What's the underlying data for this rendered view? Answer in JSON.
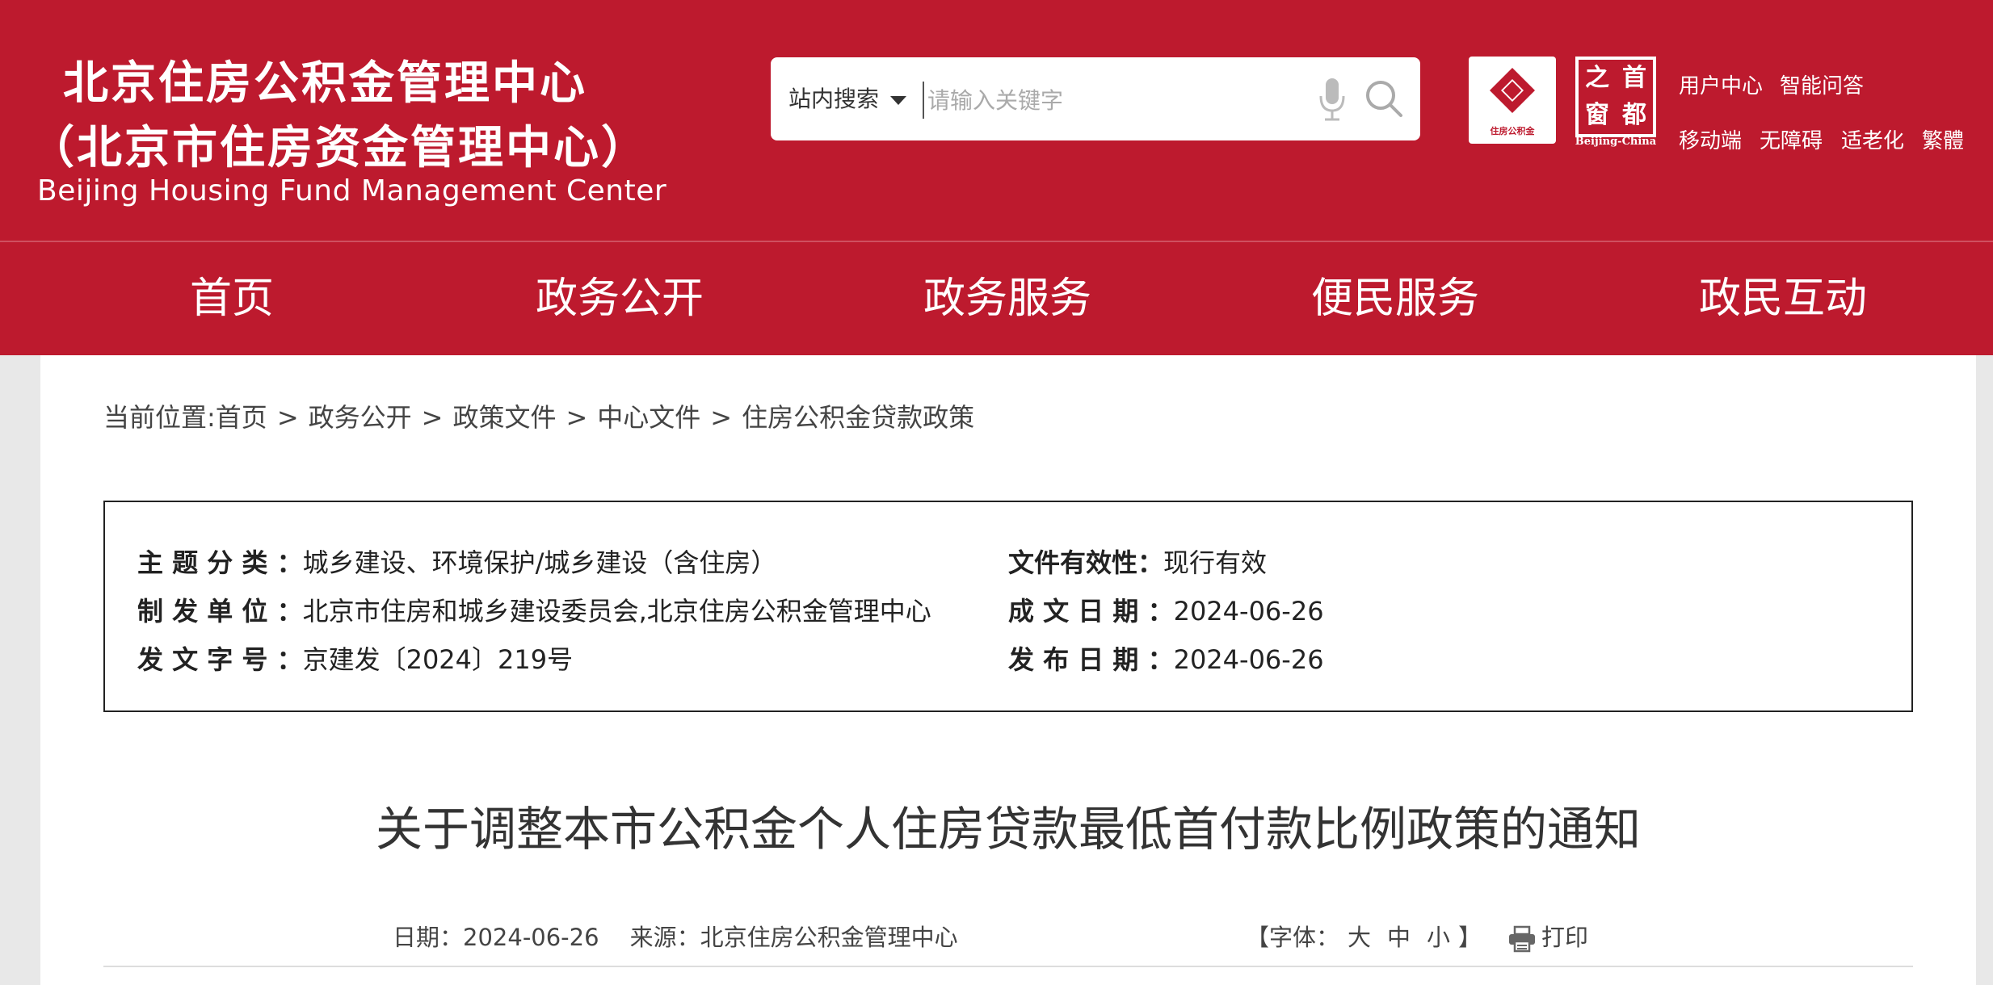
{
  "header": {
    "title_cn": "北京住房公积金管理中心",
    "subtitle_cn": "（北京市住房资金管理中心）",
    "title_en": "Beijing Housing Fund Management Center",
    "brand_color": "#bd1a2e"
  },
  "search": {
    "scope": "站内搜索",
    "placeholder": "请输入关键字",
    "mic_icon": "mic-icon",
    "search_icon": "search-icon"
  },
  "badges": {
    "fund_logo_text": "住房公积金",
    "capital_window_chars": [
      "之",
      "首",
      "窗",
      "都"
    ],
    "capital_window_en": "Beijing-China"
  },
  "top_links": {
    "row1": [
      "用户中心",
      "智能问答"
    ],
    "row2": [
      "移动端",
      "无障碍",
      "适老化",
      "繁體"
    ]
  },
  "nav": [
    "首页",
    "政务公开",
    "政务服务",
    "便民服务",
    "政民互动"
  ],
  "breadcrumb": {
    "prefix": "当前位置:",
    "items": [
      "首页",
      "政务公开",
      "政策文件",
      "中心文件",
      "住房公积金贷款政策"
    ],
    "separator": ">"
  },
  "meta": {
    "topic_label": "主 题 分 类 ：",
    "topic_value": "城乡建设、环境保护/城乡建设（含住房）",
    "issuer_label": "制 发 单 位 ：",
    "issuer_value": "北京市住房和城乡建设委员会,北京住房公积金管理中心",
    "docno_label": "发 文 字 号 ：",
    "docno_value": "京建发〔2024〕219号",
    "validity_label": "文件有效性：",
    "validity_value": "现行有效",
    "written_label": "成 文 日 期 ：",
    "written_value": "2024-06-26",
    "published_label": "发 布 日 期 ：",
    "published_value": "2024-06-26"
  },
  "article": {
    "title": "关于调整本市公积金个人住房贷款最低首付款比例政策的通知",
    "date_label": "日期：",
    "date_value": "2024-06-26",
    "source_label": "来源：",
    "source_value": "北京住房公积金管理中心",
    "font_prefix": "【字体：",
    "font_large": "大",
    "font_medium": "中",
    "font_small": "小",
    "font_suffix": "】",
    "print_label": "打印"
  }
}
